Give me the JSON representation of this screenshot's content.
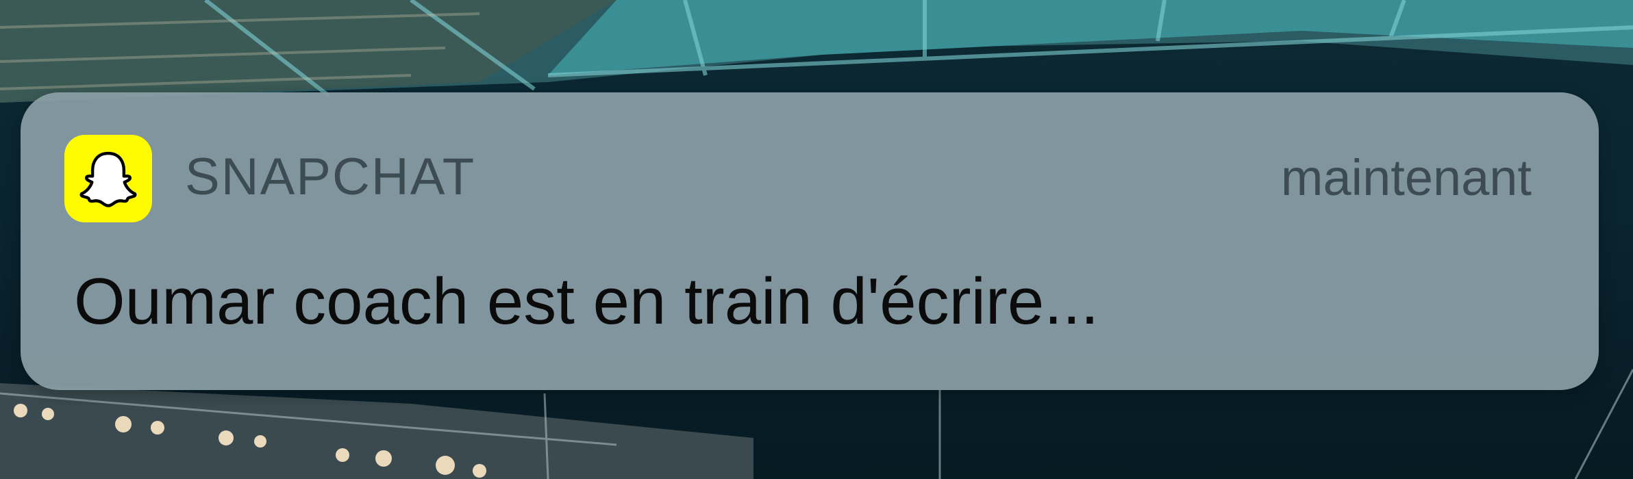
{
  "notification": {
    "app_name": "SNAPCHAT",
    "timestamp": "maintenant",
    "message": "Oumar coach est en train d'écrire...",
    "icon": "snapchat-ghost-icon",
    "icon_color": "#FFFC00"
  }
}
